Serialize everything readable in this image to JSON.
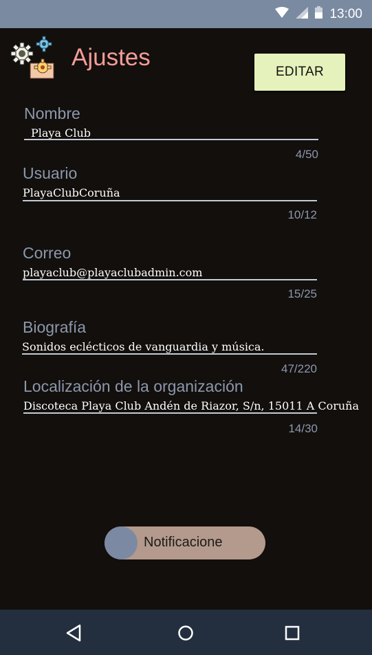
{
  "status_bar": {
    "time": "13:00",
    "icons": [
      "wifi-icon",
      "signal-icon",
      "battery-icon"
    ]
  },
  "header": {
    "title": "Ajustes",
    "edit_label": "EDITAR",
    "logo_icon": "gears-settings-icon"
  },
  "fields": {
    "nombre": {
      "label": "Nombre",
      "value": "Playa Club",
      "counter": "4/50"
    },
    "usuario": {
      "label": "Usuario",
      "value": "PlayaClubCoruña",
      "counter": "10/12"
    },
    "correo": {
      "label": "Correo",
      "value": "playaclub@playaclubadmin.com",
      "counter": "15/25"
    },
    "biografia": {
      "label": "Biografía",
      "value": "Sonidos eclécticos de vanguardia y música.",
      "counter": "47/220"
    },
    "localizacion": {
      "label": "Localización de la organización",
      "value": "Discoteca Playa Club Andén de Riazor, S/n, 15011 A Coruña",
      "counter": "14/30"
    }
  },
  "notifications_toggle": {
    "label": "Notificacione",
    "state": "off"
  },
  "nav_bar": {
    "icons": [
      "back-icon",
      "home-icon",
      "recents-icon"
    ]
  },
  "colors": {
    "accent_title": "#f49c97",
    "edit_button": "#e6f2bb",
    "toggle_track": "#b49a8c",
    "toggle_knob": "#7b8aa2"
  }
}
